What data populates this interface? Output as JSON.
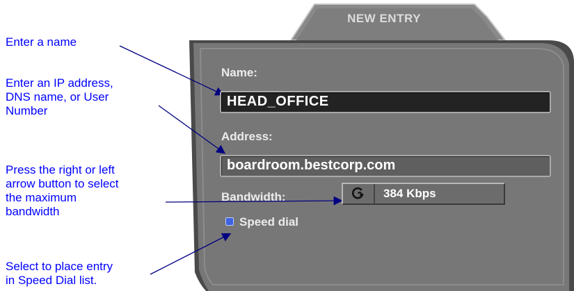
{
  "callouts": {
    "name": "Enter a name",
    "address": "Enter an IP address,\nDNS name, or User\nNumber",
    "bandwidth": "Press the right or left\narrow button to select\nthe maximum\nbandwidth",
    "speed_dial": "Select to place entry\nin Speed Dial list."
  },
  "dialog": {
    "title": "NEW ENTRY",
    "name_label": "Name:",
    "name_value": "HEAD_OFFICE",
    "address_label": "Address:",
    "address_value": "boardroom.bestcorp.com",
    "bandwidth_label": "Bandwidth:",
    "bandwidth_value": "384 Kbps",
    "bandwidth_icon": "refresh-icon",
    "speed_dial_label": "Speed dial",
    "speed_dial_checked": true
  },
  "colors": {
    "callout_text": "#0000ff",
    "arrow": "#000080",
    "panel": "#777777",
    "checkbox": "#3c64e0"
  }
}
